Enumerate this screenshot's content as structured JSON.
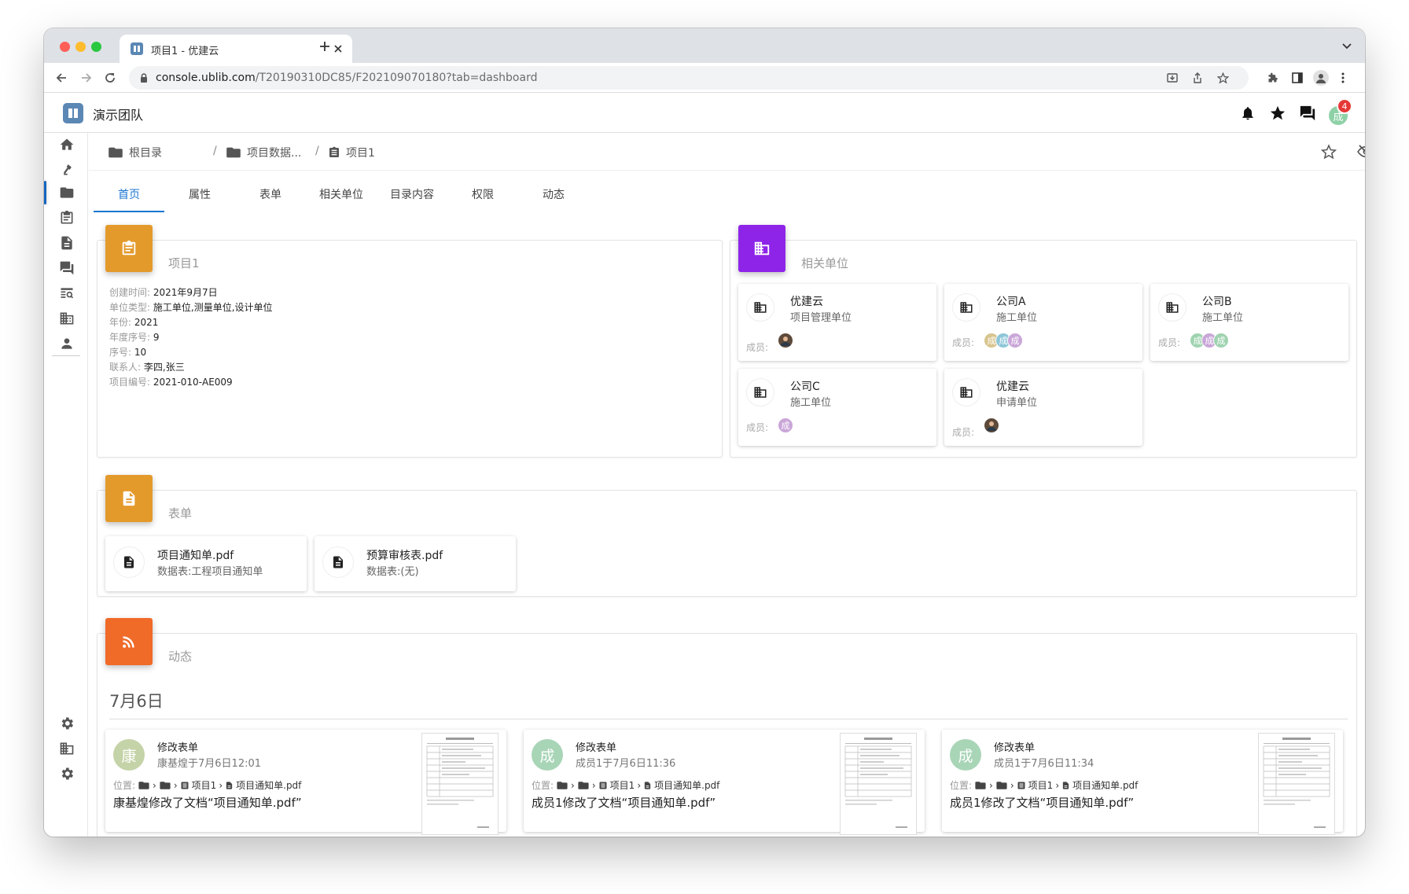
{
  "browser": {
    "tab_title": "项目1 - 优建云",
    "url_host": "console.ublib.com",
    "url_path": "/T20190310DC85/F202109070180?tab=dashboard"
  },
  "header": {
    "team_name": "演示团队",
    "notification_count": "4",
    "avatar_char": "成"
  },
  "breadcrumb": {
    "root": "根目录",
    "sep": "/",
    "folder": "项目数据...",
    "current": "项目1"
  },
  "tabs": [
    "首页",
    "属性",
    "表单",
    "相关单位",
    "目录内容",
    "权限",
    "动态"
  ],
  "project": {
    "title": "项目1",
    "fields": [
      {
        "key": "创建时间:",
        "value": "2021年9月7日"
      },
      {
        "key": "单位类型:",
        "value": "施工单位,测量单位,设计单位"
      },
      {
        "key": "年份:",
        "value": "2021"
      },
      {
        "key": "年度序号:",
        "value": "9"
      },
      {
        "key": "序号:",
        "value": "10"
      },
      {
        "key": "联系人:",
        "value": "李四,张三"
      },
      {
        "key": "项目编号:",
        "value": "2021-010-AE009"
      }
    ]
  },
  "units": {
    "title": "相关单位",
    "member_label": "成员:",
    "items": [
      {
        "name": "优建云",
        "role": "项目管理单位",
        "members": [
          "photo"
        ]
      },
      {
        "name": "公司A",
        "role": "施工单位",
        "members": [
          "成",
          "成",
          "成"
        ]
      },
      {
        "name": "公司B",
        "role": "施工单位",
        "members": [
          "成",
          "成",
          "成"
        ]
      },
      {
        "name": "公司C",
        "role": "施工单位",
        "members": [
          "成"
        ]
      },
      {
        "name": "优建云",
        "role": "申请单位",
        "members": [
          "photo"
        ]
      }
    ]
  },
  "forms": {
    "title": "表单",
    "items": [
      {
        "name": "项目通知单.pdf",
        "desc": "数据表:工程项目通知单"
      },
      {
        "name": "预算审核表.pdf",
        "desc": "数据表:(无)"
      }
    ]
  },
  "activity": {
    "title": "动态",
    "date": "7月6日",
    "loc_label": "位置:",
    "items": [
      {
        "avatar": "康",
        "color": "#c5d3a8",
        "action": "修改表单",
        "meta": "康基煌于7月6日12:01",
        "crumb1": "项目1",
        "crumb2": "项目通知单.pdf",
        "message": "康基煌修改了文档“项目通知单.pdf”"
      },
      {
        "avatar": "成",
        "color": "#a9d5b7",
        "action": "修改表单",
        "meta": "成员1于7月6日11:36",
        "crumb1": "项目1",
        "crumb2": "项目通知单.pdf",
        "message": "成员1修改了文档“项目通知单.pdf”"
      },
      {
        "avatar": "成",
        "color": "#a9d5b7",
        "action": "修改表单",
        "meta": "成员1于7月6日11:34",
        "crumb1": "项目1",
        "crumb2": "项目通知单.pdf",
        "message": "成员1修改了文档“项目通知单.pdf”"
      }
    ]
  },
  "colors": {
    "accent": "#1976d2",
    "project_icon": "#e49a2b",
    "units_icon": "#8e24e8",
    "forms_icon": "#e49a2b",
    "activity_icon": "#f06a28"
  }
}
